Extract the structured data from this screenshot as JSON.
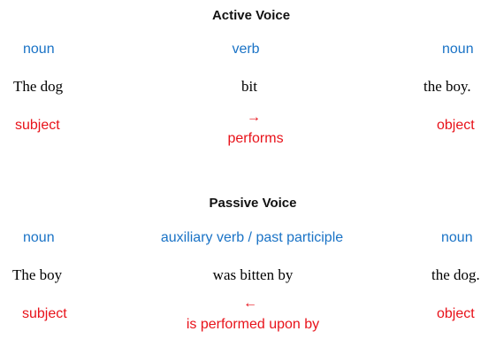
{
  "colors": {
    "role": "#1a73c6",
    "relation": "#e8121a",
    "text": "#000000"
  },
  "active": {
    "title": "Active Voice",
    "roles": [
      "noun",
      "verb",
      "noun"
    ],
    "words": [
      "The dog",
      "bit",
      "the boy."
    ],
    "subject": "subject",
    "arrow": "→",
    "relation": "performs",
    "object": "object"
  },
  "passive": {
    "title": "Passive Voice",
    "roles": [
      "noun",
      "auxiliary verb / past participle",
      "noun"
    ],
    "words": [
      "The boy",
      "was bitten by",
      "the dog."
    ],
    "subject": "subject",
    "arrow": "←",
    "relation": "is performed upon by",
    "object": "object"
  }
}
